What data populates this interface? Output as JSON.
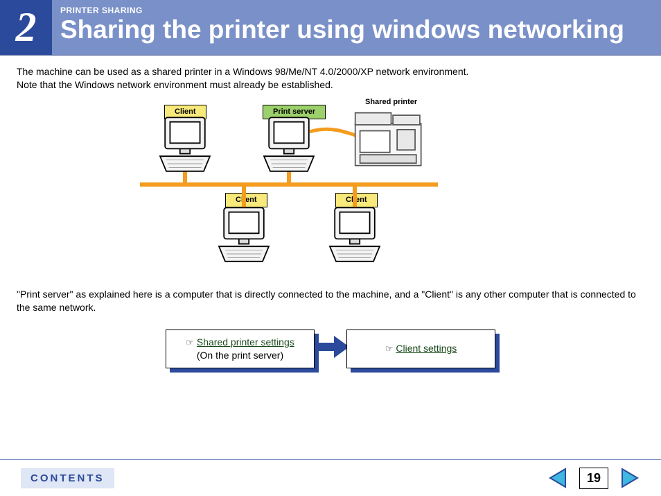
{
  "header": {
    "chapter": "2",
    "section_label": "PRINTER SHARING",
    "title": "Sharing the printer using windows networking"
  },
  "intro": {
    "line1": "The machine can be used as a shared printer in a Windows 98/Me/NT 4.0/2000/XP network environment.",
    "line2": "Note that the Windows network environment must already be established."
  },
  "diagram": {
    "labels": {
      "client_top_left": "Client",
      "print_server": "Print server",
      "shared_printer": "Shared printer",
      "client_bottom_left": "Client",
      "client_bottom_right": "Client"
    }
  },
  "note": "\"Print server\" as explained here is a computer that is directly connected to the machine, and a \"Client\" is any other computer that is connected to the same network.",
  "links": {
    "shared_settings": "Shared printer settings",
    "shared_sub": "(On the print server)",
    "client_settings": "Client settings"
  },
  "footer": {
    "contents": "CONTENTS",
    "page": "19"
  }
}
